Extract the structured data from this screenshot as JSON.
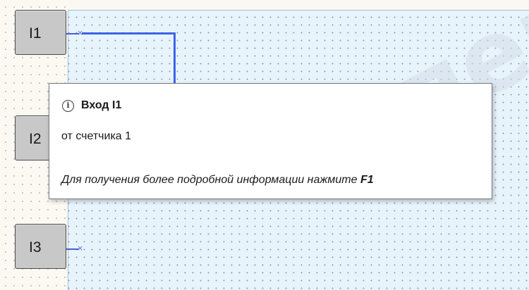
{
  "inputs": [
    {
      "label": "I1"
    },
    {
      "label": "I2"
    },
    {
      "label": "I3"
    }
  ],
  "stub_marker": "×",
  "watermark": "супер",
  "tooltip": {
    "icon": "info-icon",
    "title": "Вход I1",
    "description": "от счетчика 1",
    "hint_text": "Для получения более подробной информации нажмите ",
    "hint_key": "F1"
  },
  "colors": {
    "canvas": "#e8f4fc",
    "wire": "#3e63e8",
    "input_block": "#c8c8c8"
  }
}
